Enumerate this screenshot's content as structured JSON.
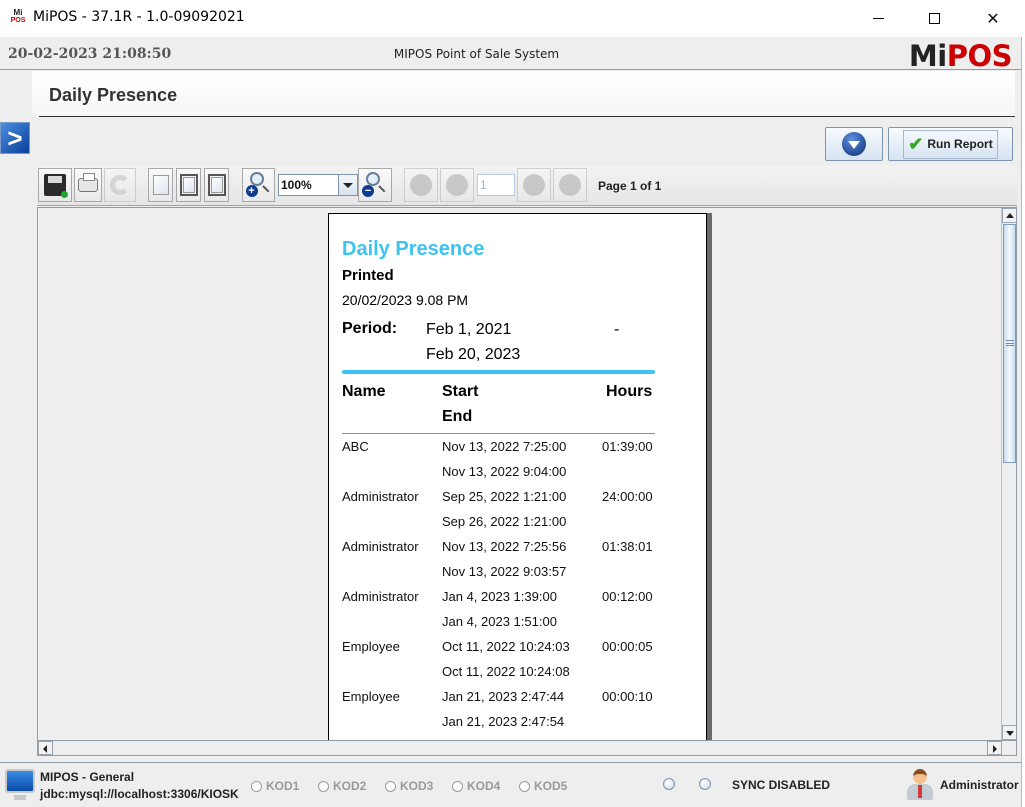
{
  "window": {
    "title": "MiPOS - 37.1R - 1.0-09092021",
    "icon_top": "Mi",
    "icon_bottom": "POS"
  },
  "topbar": {
    "datetime": "20-02-2023 21:08:50",
    "system_name": "MIPOS Point of Sale System",
    "logo_mi": "Mi",
    "logo_pos": "POS"
  },
  "page": {
    "title": "Daily Presence",
    "side_toggle": ">",
    "run_report_label": "Run Report"
  },
  "toolbar": {
    "zoom_value": "100%",
    "page_input": "1",
    "page_label": "Page 1 of 1"
  },
  "report": {
    "title": "Daily Presence",
    "printed_label": "Printed",
    "printed_value": "20/02/2023 9.08 PM",
    "period_label": "Period:",
    "period_from": "Feb 1, 2021",
    "period_dash": "-",
    "period_to": "Feb 20, 2023",
    "accent_color": "#3cc3f2",
    "columns": {
      "name": "Name",
      "start": "Start",
      "end": "End",
      "hours": "Hours"
    },
    "rows": [
      {
        "name": "ABC",
        "start": "Nov 13, 2022 7:25:00",
        "end": "Nov 13, 2022 9:04:00",
        "hours": "01:39:00"
      },
      {
        "name": "Administrator",
        "start": "Sep 25, 2022 1:21:00",
        "end": "Sep 26, 2022 1:21:00",
        "hours": "24:00:00"
      },
      {
        "name": "Administrator",
        "start": "Nov 13, 2022 7:25:56",
        "end": "Nov 13, 2022 9:03:57",
        "hours": "01:38:01"
      },
      {
        "name": "Administrator",
        "start": "Jan 4, 2023 1:39:00",
        "end": "Jan 4, 2023 1:51:00",
        "hours": "00:12:00"
      },
      {
        "name": "Employee",
        "start": "Oct 11, 2022 10:24:03",
        "end": "Oct 11, 2022 10:24:08",
        "hours": "00:00:05"
      },
      {
        "name": "Employee",
        "start": "Jan 21, 2023 2:47:44",
        "end": "Jan 21, 2023 2:47:54",
        "hours": "00:00:10"
      }
    ]
  },
  "statusbar": {
    "db_name": "MIPOS - General",
    "db_url": "jdbc:mysql://localhost:3306/KIOSK",
    "kods": [
      "KOD1",
      "KOD2",
      "KOD3",
      "KOD4",
      "KOD5"
    ],
    "sync_status": "SYNC DISABLED",
    "user": "Administrator"
  }
}
